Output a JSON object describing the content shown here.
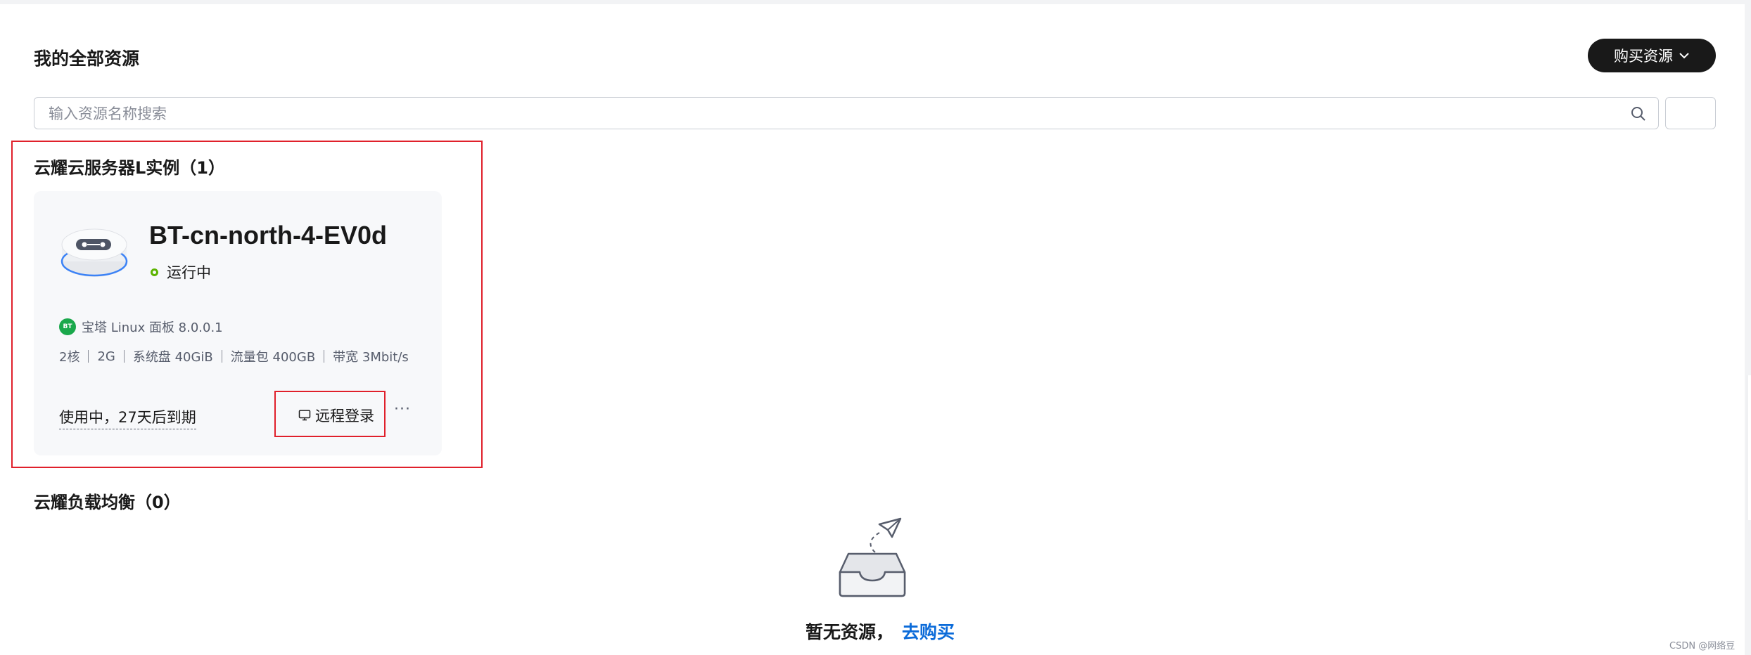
{
  "header": {
    "title": "我的全部资源",
    "buy_button_label": "购买资源"
  },
  "search": {
    "placeholder": "输入资源名称搜索",
    "value": ""
  },
  "sections": {
    "instances": {
      "title": "云耀云服务器L实例（1）",
      "card": {
        "name": "BT-cn-north-4-EV0d",
        "status": "运行中",
        "image_badge": "BT",
        "image": "宝塔 Linux 面板 8.0.0.1",
        "specs": [
          "2核",
          "2G",
          "系统盘 40GiB",
          "流量包 400GB",
          "带宽 3Mbit/s"
        ],
        "expiry": "使用中，27天后到期",
        "remote_login_label": "远程登录",
        "more_label": "···"
      }
    },
    "load_balancers": {
      "title": "云耀负载均衡（0）",
      "empty_text": "暂无资源，",
      "buy_link": "去购买"
    }
  },
  "watermark": "CSDN @网络豆",
  "colors": {
    "primary_button": "#191919",
    "status_running": "#5cb300",
    "link": "#0b6bd9",
    "highlight_box": "#e0202b",
    "card_background": "#f7f8fa"
  },
  "icons": [
    "search-icon",
    "chevron-down-icon",
    "monitor-icon",
    "bt-logo-icon",
    "server-image",
    "empty-inbox-icon"
  ]
}
